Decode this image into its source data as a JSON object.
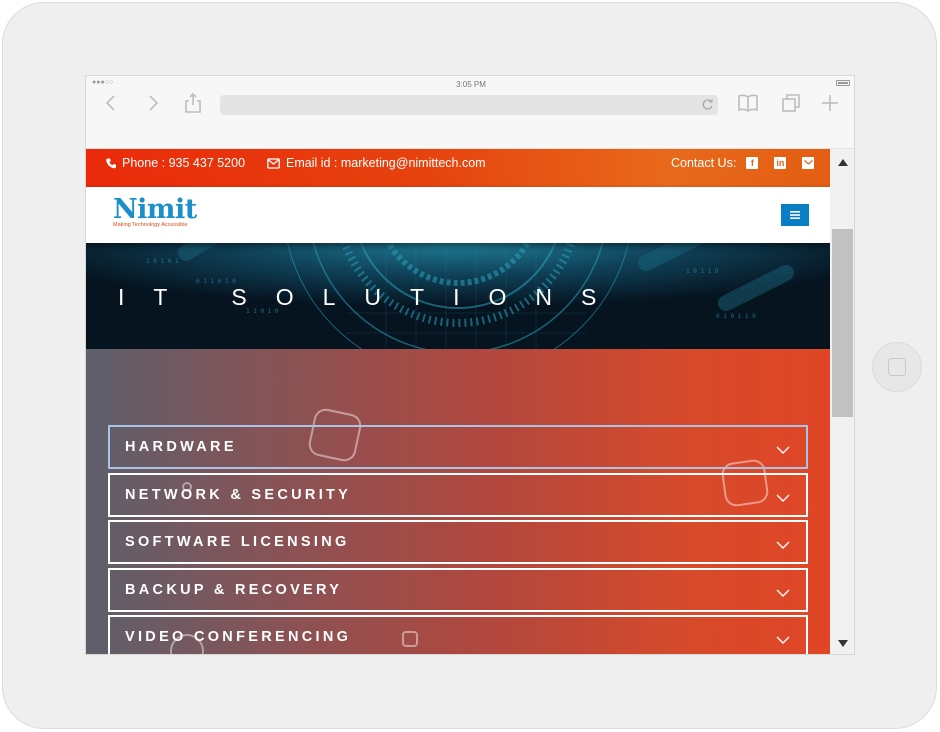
{
  "status_bar": {
    "signal": "●●●○○",
    "time": "3:05 PM"
  },
  "browser": {
    "back_icon": "chevron-left-icon",
    "forward_icon": "chevron-right-icon",
    "share_icon": "share-icon",
    "reload_icon": "reload-icon",
    "bookmarks_icon": "book-icon",
    "tabs_icon": "tabs-icon",
    "new_tab_icon": "plus-icon"
  },
  "topbar": {
    "phone": "Phone : 935 437 5200",
    "email": "Email id : marketing@nimittech.com",
    "contact_label": "Contact Us:",
    "social": [
      "facebook-icon",
      "linkedin-icon",
      "mail-icon"
    ]
  },
  "header": {
    "logo_text": "Nimit",
    "logo_tagline": "Making Technology Accessible",
    "menu_icon": "hamburger-icon"
  },
  "hero": {
    "title": "IT SOLUTIONS"
  },
  "accordion": {
    "items": [
      {
        "label": "HARDWARE"
      },
      {
        "label": "NETWORK & SECURITY"
      },
      {
        "label": "SOFTWARE LICENSING"
      },
      {
        "label": "BACKUP & RECOVERY"
      },
      {
        "label": "VIDEO CONFERENCING"
      }
    ]
  },
  "colors": {
    "topbar_start": "#ea2a0a",
    "topbar_end": "#e8691b",
    "brand_blue": "#1a8fc9",
    "menu_button": "#0a7ec4",
    "content_start": "#5d5f6b",
    "content_end": "#e04626"
  }
}
